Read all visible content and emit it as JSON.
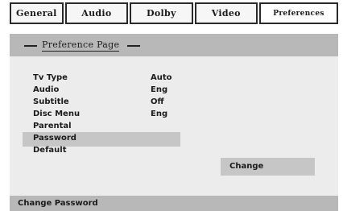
{
  "tabs": [
    {
      "label": "General"
    },
    {
      "label": "Audio"
    },
    {
      "label": "Dolby"
    },
    {
      "label": "Video"
    },
    {
      "label": "Preferences"
    }
  ],
  "panel": {
    "title": "Preference Page",
    "rows": [
      {
        "label": "Tv Type",
        "value": "Auto"
      },
      {
        "label": "Audio",
        "value": "Eng"
      },
      {
        "label": "Subtitle",
        "value": "Off"
      },
      {
        "label": "Disc Menu",
        "value": "Eng"
      },
      {
        "label": "Parental",
        "value": ""
      },
      {
        "label": "Password",
        "value": ""
      },
      {
        "label": "Default",
        "value": ""
      }
    ],
    "change_button": "Change"
  },
  "status_text": "Change Password"
}
